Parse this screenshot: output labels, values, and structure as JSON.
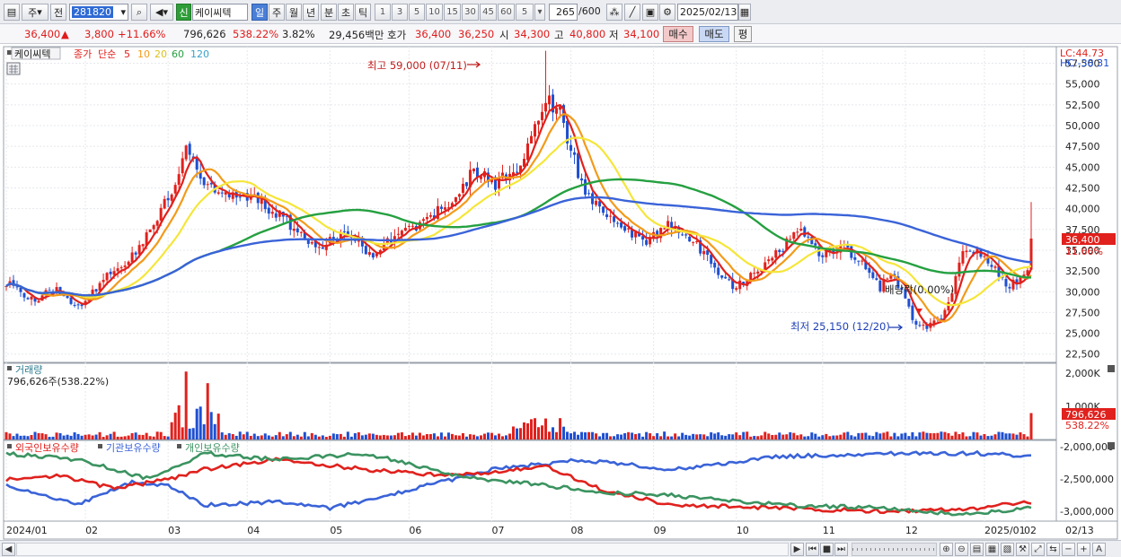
{
  "toolbar": {
    "period_type": "주",
    "prev_label": "전",
    "stock_code": "281820",
    "stock_name": "케이씨텍",
    "sin_badge": "신",
    "period_tabs": [
      "일",
      "주",
      "월",
      "년",
      "분",
      "초",
      "틱"
    ],
    "active_tab": "일",
    "interval_buttons": [
      "1",
      "3",
      "5",
      "10",
      "15",
      "30",
      "45",
      "60"
    ],
    "interval_value": "5",
    "bar_count": "265",
    "bar_total": "/600",
    "date": "2025/02/13"
  },
  "quote": {
    "price": "36,400",
    "up_arrow": "▲",
    "change": "3,800",
    "change_pct": "+11.66%",
    "volume": "796,626",
    "volume_ratio": "538.22%",
    "turnover": "3.82%",
    "trade_value": "29,456백만",
    "hoga_label": "호가",
    "ask": "36,400",
    "bid": "36,250",
    "open_label": "시",
    "open": "34,300",
    "high_label": "고",
    "high": "40,800",
    "low_label": "저",
    "low": "34,100",
    "buy_button": "매수",
    "sell_button": "매도",
    "eq_button": "평"
  },
  "legend": {
    "name": "케이씨텍",
    "close_label": "종가",
    "ma_label": "단순",
    "ma_periods": [
      "5",
      "10",
      "20",
      "60",
      "120"
    ]
  },
  "annotations": {
    "high_note": "최고 59,000 (07/11)",
    "low_note": "최저 25,150 (12/20)",
    "dividend_note": "배당락(0.00%)",
    "lc": "LC:44.73",
    "hc": "HC:-38.31",
    "price_tag": "36,400",
    "pct_tag": "11.66%",
    "vol_tag": "796,626",
    "vol_pct_tag": "538.22%"
  },
  "volume_panel": {
    "title": "거래량",
    "readout": "796,626주(538.22%)"
  },
  "holdings_panel": {
    "series": [
      "외국인보유수량",
      "기관보유수량",
      "개인보유수량"
    ]
  },
  "colors": {
    "candle_up": "#e0211d",
    "candle_down": "#1e4fd0",
    "ma5": "#e0211d",
    "ma10": "#f39a1a",
    "ma20": "#f5e63a",
    "ma60": "#25a040",
    "ma120": "#3a63d8",
    "foreign": "#3a63d8",
    "institution": "#e0211d",
    "individual": "#3b9360"
  },
  "chart_data": [
    {
      "type": "candlestick",
      "title": "케이씨텍",
      "y_ticks": [
        22500,
        25000,
        27500,
        30000,
        32500,
        35000,
        37500,
        40000,
        42500,
        45000,
        47500,
        50000,
        52500,
        55000,
        57500
      ],
      "ylim": [
        21500,
        59500
      ],
      "x_labels": [
        "2024/01",
        "02",
        "03",
        "04",
        "05",
        "06",
        "07",
        "08",
        "09",
        "10",
        "11",
        "12",
        "2025/01",
        "02",
        "02/13"
      ],
      "bars": 265,
      "anchors": [
        {
          "i": 0,
          "c": 31000
        },
        {
          "i": 8,
          "c": 29000
        },
        {
          "i": 14,
          "c": 30500
        },
        {
          "i": 20,
          "c": 28000
        },
        {
          "i": 27,
          "c": 31500
        },
        {
          "i": 34,
          "c": 33500
        },
        {
          "i": 40,
          "c": 37500
        },
        {
          "i": 46,
          "c": 42000
        },
        {
          "i": 50,
          "c": 47500
        },
        {
          "i": 55,
          "c": 43500
        },
        {
          "i": 62,
          "c": 41500
        },
        {
          "i": 70,
          "c": 41000
        },
        {
          "i": 78,
          "c": 38500
        },
        {
          "i": 86,
          "c": 35000
        },
        {
          "i": 94,
          "c": 37000
        },
        {
          "i": 102,
          "c": 34500
        },
        {
          "i": 108,
          "c": 36500
        },
        {
          "i": 116,
          "c": 38500
        },
        {
          "i": 124,
          "c": 41000
        },
        {
          "i": 130,
          "c": 44500
        },
        {
          "i": 136,
          "c": 43000
        },
        {
          "i": 142,
          "c": 45000
        },
        {
          "i": 146,
          "c": 48500
        },
        {
          "i": 150,
          "c": 53500
        },
        {
          "i": 154,
          "c": 51500
        },
        {
          "i": 160,
          "c": 43000
        },
        {
          "i": 166,
          "c": 39500
        },
        {
          "i": 172,
          "c": 37500
        },
        {
          "i": 178,
          "c": 36000
        },
        {
          "i": 184,
          "c": 38000
        },
        {
          "i": 190,
          "c": 36500
        },
        {
          "i": 196,
          "c": 33500
        },
        {
          "i": 202,
          "c": 30500
        },
        {
          "i": 208,
          "c": 32000
        },
        {
          "i": 214,
          "c": 34500
        },
        {
          "i": 220,
          "c": 37500
        },
        {
          "i": 226,
          "c": 34500
        },
        {
          "i": 232,
          "c": 35500
        },
        {
          "i": 238,
          "c": 33500
        },
        {
          "i": 243,
          "c": 30500
        },
        {
          "i": 246,
          "c": 32500
        },
        {
          "i": 250,
          "c": 29000
        },
        {
          "i": 253,
          "c": 26000
        },
        {
          "i": 256,
          "c": 25500
        },
        {
          "i": 259,
          "c": 26500
        },
        {
          "i": 262,
          "c": 28500
        },
        {
          "i": 266,
          "c": 34500
        },
        {
          "i": 270,
          "c": 35000
        },
        {
          "i": 274,
          "c": 33500
        },
        {
          "i": 278,
          "c": 30500
        },
        {
          "i": 282,
          "c": 31500
        },
        {
          "i": 284,
          "c": 32600
        },
        {
          "i": 285,
          "c": 36400
        }
      ],
      "moving_averages": [
        "5",
        "10",
        "20",
        "60",
        "120"
      ]
    },
    {
      "type": "bar",
      "title": "거래량",
      "y_ticks": [
        1000000,
        2000000
      ],
      "y_tick_labels": [
        "1,000K",
        "2,000K"
      ],
      "last_value": 796626
    },
    {
      "type": "line",
      "title": "보유수량",
      "series": [
        {
          "name": "외국인보유수량"
        },
        {
          "name": "기관보유수량"
        },
        {
          "name": "개인보유수량"
        }
      ],
      "y_ticks": [
        -2000000,
        -2500000,
        -3000000
      ],
      "y_tick_labels": [
        "-2,000,000",
        "-2,500,000",
        "-3,000,000"
      ]
    }
  ]
}
